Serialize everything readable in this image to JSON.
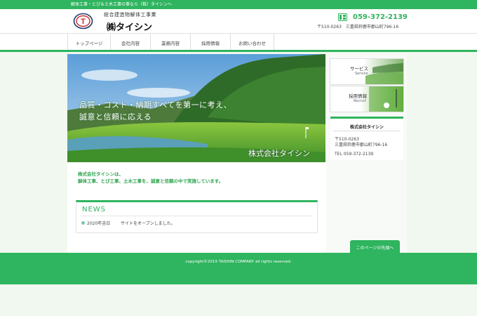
{
  "topbar": {
    "text": "解体工事・とび＆土木工事の事なら（株）タイシンへ"
  },
  "header": {
    "tagline": "総合建造物解体工事業",
    "company": "㈱タイシン",
    "logo_letter": "T",
    "phone": "059-372-2139",
    "address": "〒510-0263　三重県鈴鹿市郡山町796-16"
  },
  "nav": {
    "items": [
      {
        "label": "トップページ"
      },
      {
        "label": "会社内容"
      },
      {
        "label": "業務内容"
      },
      {
        "label": "採用情報"
      },
      {
        "label": "お問い合わせ"
      }
    ]
  },
  "hero": {
    "catch_line1": "品質・コスト・納期すべてを第一に考え、",
    "catch_line2": "誠意と信頼に応える",
    "company_name": "株式会社タイシン"
  },
  "intro": {
    "line1": "株式会社タイシンは、",
    "line2": "解体工事、とび工事、土木工事を、誠意と信頼の中で実施しています。"
  },
  "news": {
    "title": "NEWS",
    "items": [
      {
        "date": "2020年吉日",
        "text": "サイトをオープンしました。"
      }
    ]
  },
  "sidebar": {
    "banners": [
      {
        "label": "サービス",
        "sub": "Service"
      },
      {
        "label": "採用情報",
        "sub": "Recruit"
      }
    ],
    "info": {
      "name": "株式会社タイシン",
      "postal": "〒510-0263",
      "address": "三重県鈴鹿市郡山町796-16",
      "tel": "TEL 059-372-2139"
    }
  },
  "pagetop": {
    "label": "このページの先頭へ"
  },
  "footer": {
    "copyright": "copyright©2019 TAISHIN COMPANY all rights reserved."
  },
  "colors": {
    "brand_green": "#2fb45f",
    "page_bg": "#f1f8ef",
    "logo_red": "#c9302c",
    "logo_navy": "#1e3a6e"
  }
}
